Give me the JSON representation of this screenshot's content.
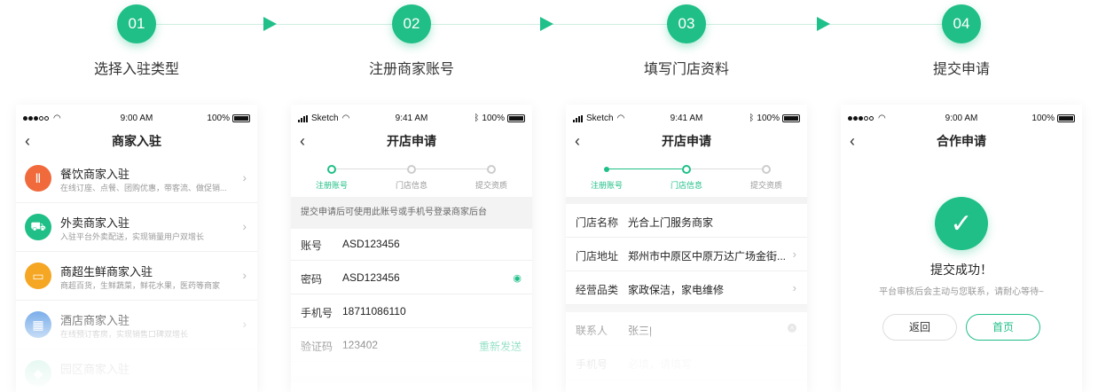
{
  "colors": {
    "accent": "#1fbf87"
  },
  "steps": [
    {
      "num": "01",
      "label": "选择入驻类型"
    },
    {
      "num": "02",
      "label": "注册商家账号"
    },
    {
      "num": "03",
      "label": "填写门店资料"
    },
    {
      "num": "04",
      "label": "提交申请"
    }
  ],
  "phone1": {
    "status_time": "9:00 AM",
    "status_battery": "100%",
    "title": "商家入驻",
    "items": [
      {
        "title": "餐饮商家入驻",
        "sub": "在线订座、点餐、团购优惠，带客流、做促销...",
        "icon": "utensils-icon",
        "color": "#f06a3c"
      },
      {
        "title": "外卖商家入驻",
        "sub": "入驻平台外卖配送，实现销量用户双增长",
        "icon": "delivery-scooter-icon",
        "color": "#1fbf87"
      },
      {
        "title": "商超生鲜商家入驻",
        "sub": "商超百货，生鲜蔬菜，鲜花水果，医药等商家",
        "icon": "basket-icon",
        "color": "#f5a623"
      },
      {
        "title": "酒店商家入驻",
        "sub": "在线预订客房，实现销售口碑双增长",
        "icon": "hotel-icon",
        "color": "#4a90e2"
      },
      {
        "title": "园区商家入驻",
        "sub": "",
        "icon": "park-icon",
        "color": "#1fbf87"
      }
    ]
  },
  "phone2": {
    "carrier": "Sketch",
    "status_time": "9:41 AM",
    "status_battery": "100%",
    "title": "开店申请",
    "progress": [
      "注册账号",
      "门店信息",
      "提交资质"
    ],
    "notice": "提交申请后可使用此账号或手机号登录商家后台",
    "fields": [
      {
        "label": "账号",
        "value": "ASD123456"
      },
      {
        "label": "密码",
        "value": "ASD123456"
      },
      {
        "label": "手机号",
        "value": "18711086110"
      },
      {
        "label": "验证码",
        "value": "123402",
        "action": "重新发送"
      }
    ]
  },
  "phone3": {
    "carrier": "Sketch",
    "status_time": "9:41 AM",
    "status_battery": "100%",
    "title": "开店申请",
    "progress": [
      "注册账号",
      "门店信息",
      "提交资质"
    ],
    "fields": [
      {
        "label": "门店名称",
        "value": "光合上门服务商家"
      },
      {
        "label": "门店地址",
        "value": "郑州市中原区中原万达广场金街..."
      },
      {
        "label": "经营品类",
        "value": "家政保洁，家电维修"
      }
    ],
    "contact": [
      {
        "label": "联系人",
        "value": "张三|"
      },
      {
        "label": "手机号",
        "value": "必填，请填写"
      }
    ]
  },
  "phone4": {
    "status_time": "9:00 AM",
    "status_battery": "100%",
    "title": "合作申请",
    "success_title": "提交成功！",
    "success_sub": "平台审核后会主动与您联系，请耐心等待~",
    "btn_back": "返回",
    "btn_home": "首页"
  }
}
